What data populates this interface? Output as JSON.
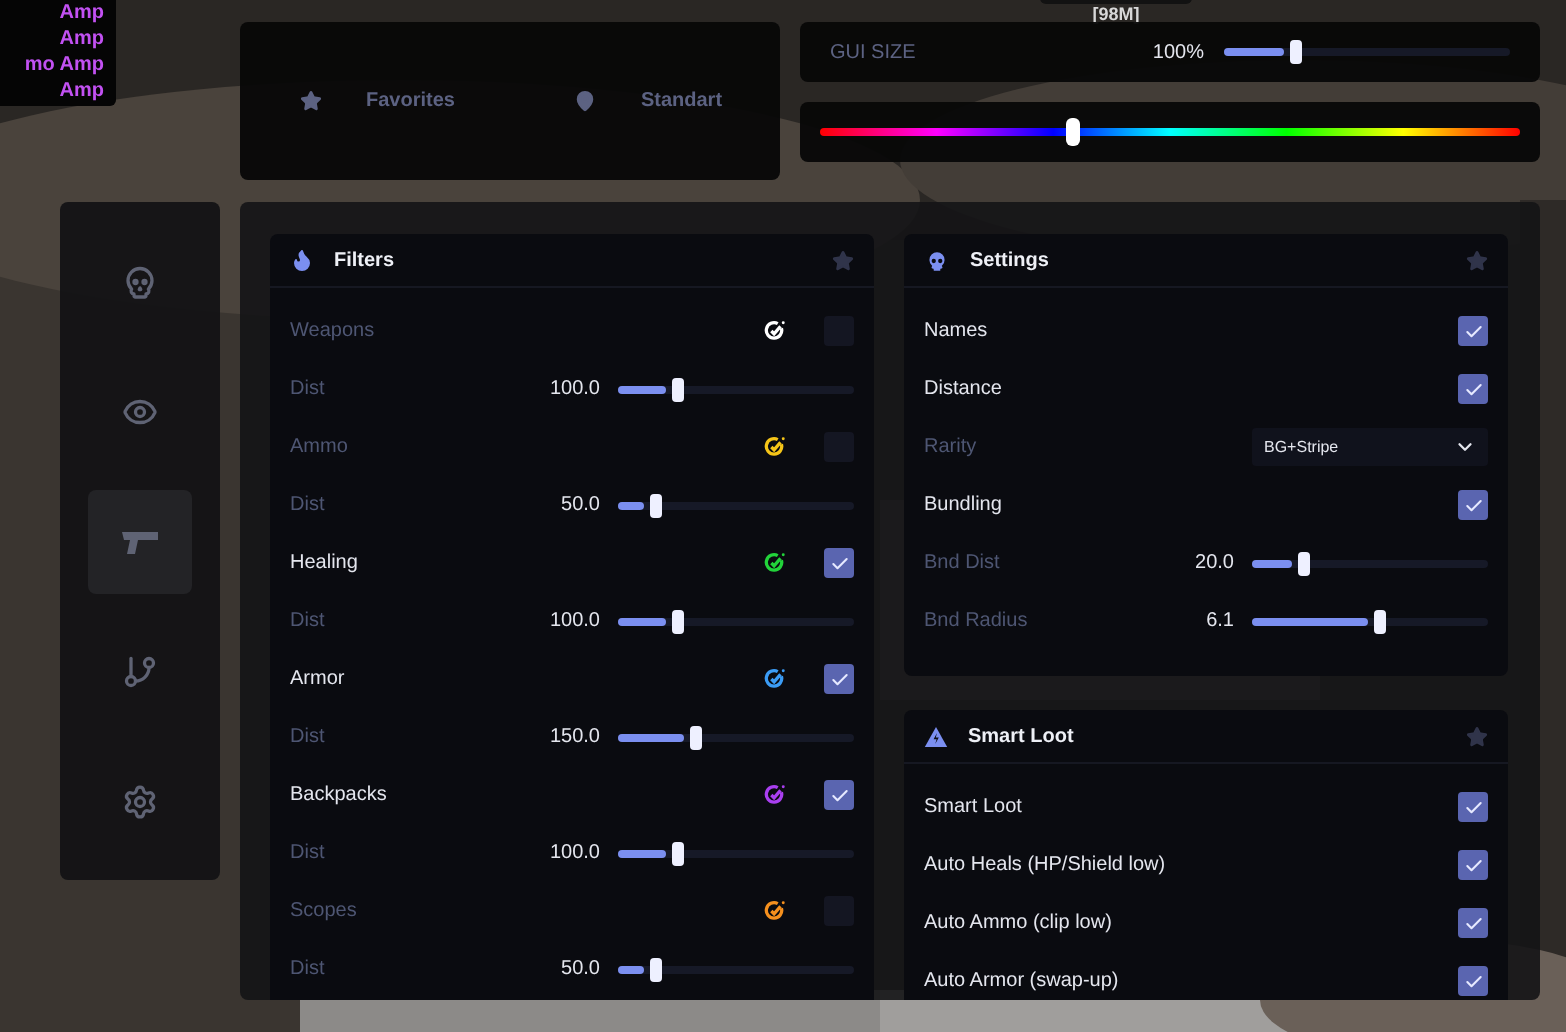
{
  "esp_list": {
    "items": [
      "Amp",
      "Amp",
      "mo Amp",
      "Amp"
    ],
    "color": "#c251f2"
  },
  "distance_tag": "[98M]",
  "quick_bar": {
    "items": [
      {
        "kind": "favorites",
        "label": "Favorites"
      },
      {
        "kind": "location",
        "label": "Standart"
      }
    ]
  },
  "gui_size": {
    "label": "GUI SIZE",
    "reading": "100%",
    "level": 0.25
  },
  "hue_slider": {
    "level": 0.36
  },
  "sidebar": {
    "items": [
      {
        "kind": "skull",
        "selected": false
      },
      {
        "kind": "eye",
        "selected": false
      },
      {
        "kind": "gun",
        "selected": true
      },
      {
        "kind": "branch",
        "selected": false
      },
      {
        "kind": "gear",
        "selected": false
      }
    ]
  },
  "filters": {
    "title": "Filters",
    "rows": [
      {
        "kind": "toggle",
        "label": "Weapons",
        "color": "#ffffff",
        "checked": false
      },
      {
        "kind": "slider",
        "label": "Dist",
        "reading": "100.0",
        "level": 0.25
      },
      {
        "kind": "toggle",
        "label": "Ammo",
        "color": "#f5c518",
        "checked": false
      },
      {
        "kind": "slider",
        "label": "Dist",
        "reading": "50.0",
        "level": 0.16
      },
      {
        "kind": "toggle",
        "label": "Healing",
        "color": "#22d33a",
        "checked": true
      },
      {
        "kind": "slider",
        "label": "Dist",
        "reading": "100.0",
        "level": 0.25
      },
      {
        "kind": "toggle",
        "label": "Armor",
        "color": "#3b9cf5",
        "checked": true
      },
      {
        "kind": "slider",
        "label": "Dist",
        "reading": "150.0",
        "level": 0.33
      },
      {
        "kind": "toggle",
        "label": "Backpacks",
        "color": "#a93ff0",
        "checked": true
      },
      {
        "kind": "slider",
        "label": "Dist",
        "reading": "100.0",
        "level": 0.25
      },
      {
        "kind": "toggle",
        "label": "Scopes",
        "color": "#f5901e",
        "checked": false
      },
      {
        "kind": "slider",
        "label": "Dist",
        "reading": "50.0",
        "level": 0.16
      }
    ]
  },
  "settings": {
    "title": "Settings",
    "rows": [
      {
        "kind": "checkbox",
        "label": "Names",
        "checked": true
      },
      {
        "kind": "checkbox",
        "label": "Distance",
        "checked": true
      },
      {
        "kind": "select",
        "label": "Rarity",
        "value": "BG+Stripe"
      },
      {
        "kind": "checkbox",
        "label": "Bundling",
        "checked": true
      },
      {
        "kind": "slider",
        "label": "Bnd Dist",
        "reading": "20.0",
        "level": 0.22
      },
      {
        "kind": "slider",
        "label": "Bnd Radius",
        "reading": "6.1",
        "level": 0.54
      }
    ]
  },
  "smart_loot": {
    "title": "Smart Loot",
    "rows": [
      {
        "kind": "checkbox",
        "label": "Smart Loot",
        "checked": true
      },
      {
        "kind": "checkbox",
        "label": "Auto Heals (HP/Shield low)",
        "checked": true
      },
      {
        "kind": "checkbox",
        "label": "Auto Ammo (clip low)",
        "checked": true
      },
      {
        "kind": "checkbox",
        "label": "Auto Armor (swap-up)",
        "checked": true
      }
    ]
  }
}
